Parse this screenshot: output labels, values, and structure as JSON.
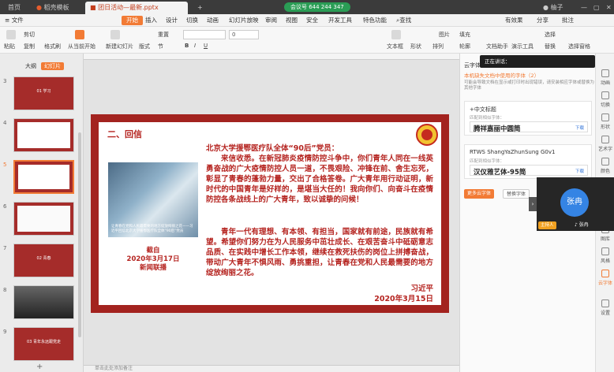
{
  "titlebar": {
    "tab_home": "首页",
    "tab_template": "稻壳模板",
    "tab_doc": "团日活动—最新.pptx",
    "add_tab": "+",
    "meeting_id": "会议号 644 244 347",
    "user": "柚子"
  },
  "menubar": {
    "file": "文件",
    "start": "开始",
    "items": [
      "插入",
      "设计",
      "切换",
      "动画",
      "幻灯片放映",
      "审阅",
      "视图",
      "安全",
      "开发工具",
      "特色功能"
    ],
    "search": "查找",
    "changes": "有效果",
    "share": "分享",
    "comment": "批注"
  },
  "toolbar": {
    "paste": "粘贴",
    "cut": "剪切",
    "copy": "复制",
    "format_painter": "格式刷",
    "from_current": "从当前开始",
    "new_slide": "新建幻灯片",
    "layout": "版式",
    "section": "节",
    "reset": "重置",
    "font_size": "0",
    "bold": "B",
    "italic": "I",
    "underline": "U",
    "textbox": "文本框",
    "shape": "形状",
    "arrange": "排列",
    "picture": "图片",
    "fill": "填充",
    "outline": "轮廓",
    "doc_assist": "文档助手",
    "presenter": "演示工具",
    "replace": "替换",
    "select": "选择",
    "select_pane": "选择窗格"
  },
  "leftpanel": {
    "tab_outline": "大纲",
    "tab_slides": "幻灯片",
    "slides": [
      {
        "num": "3",
        "title": "01 学习"
      },
      {
        "num": "4",
        "title": ""
      },
      {
        "num": "5",
        "title": ""
      },
      {
        "num": "6",
        "title": ""
      },
      {
        "num": "7",
        "title": "02 青春"
      },
      {
        "num": "8",
        "title": ""
      },
      {
        "num": "9",
        "title": "03 青年永远跟党走"
      }
    ],
    "add": "+"
  },
  "slide": {
    "section_title": "二、回信",
    "letter_title": "北京大学援鄂医疗队全体“90后”党员：",
    "para1": "来信收悉。在新冠肺炎疫情防控斗争中，你们青年人同在一线英勇奋战的广大疫情防控人员一道，不畏艰险、冲锋在前、舍生忘死，彰显了青春的蓬勃力量，交出了合格答卷。广大青年用行动证明，新时代的中国青年是好样的，是堪当大任的！我向你们、向奋斗在疫情防控各条战线上的广大青年，致以诚挚的问候！",
    "para2": "青年一代有理想、有本领、有担当，国家就有前途，民族就有希望。希望你们努力在为人民服务中茁壮成长、在艰苦奋斗中砥砺意志品质、在实践中增长工作本领，继续在救死扶伤的岗位上拼搏奋战，带动广大青年不惧风雨、勇挑重担，让青春在党和人民最需要的地方绽放绚丽之花。",
    "photo_caption": "让青春在党和人民最需要的地方绽放绚丽之花——习近平回信北京大学援鄂医疗队全体“90后”党员",
    "photo_label_1": "截自",
    "photo_label_2": "2020年3月17日",
    "photo_label_3": "新闻联播",
    "signature": "习近平",
    "date": "2020年3月15日"
  },
  "bottombar": {
    "notes": "单击此处添加备注"
  },
  "rightpanel": {
    "title": "云字体",
    "warning": "本机缺失文档中使用的字体（2）",
    "description": "可能会导致文档在显示或打印时出现错误，请安装相应字体或替换为其他字体",
    "fonts": [
      {
        "name": "+中文标题",
        "label": "匹配到相似字体：",
        "match": "腾祥嘉丽中圆简",
        "download": "下载"
      },
      {
        "name": "RTWS ShangYaZhunSung G0v1",
        "label": "匹配到相似字体：",
        "match": "汉仪雅艺体-95简",
        "download": "下载"
      }
    ],
    "more_fonts": "更多云字体",
    "replace_font": "替换字体"
  },
  "rightbar": [
    "动画",
    "切换",
    "形状",
    "艺术字",
    "颜色",
    "图库",
    "风格",
    "云字体",
    "设置"
  ],
  "toast": {
    "text": "正在讲话："
  },
  "video": {
    "name_avatar": "张冉",
    "host": "主持人",
    "name": "张冉"
  },
  "colors": {
    "accent": "#f27b35",
    "slide_red": "#a3231f",
    "text_red": "#b52420"
  }
}
